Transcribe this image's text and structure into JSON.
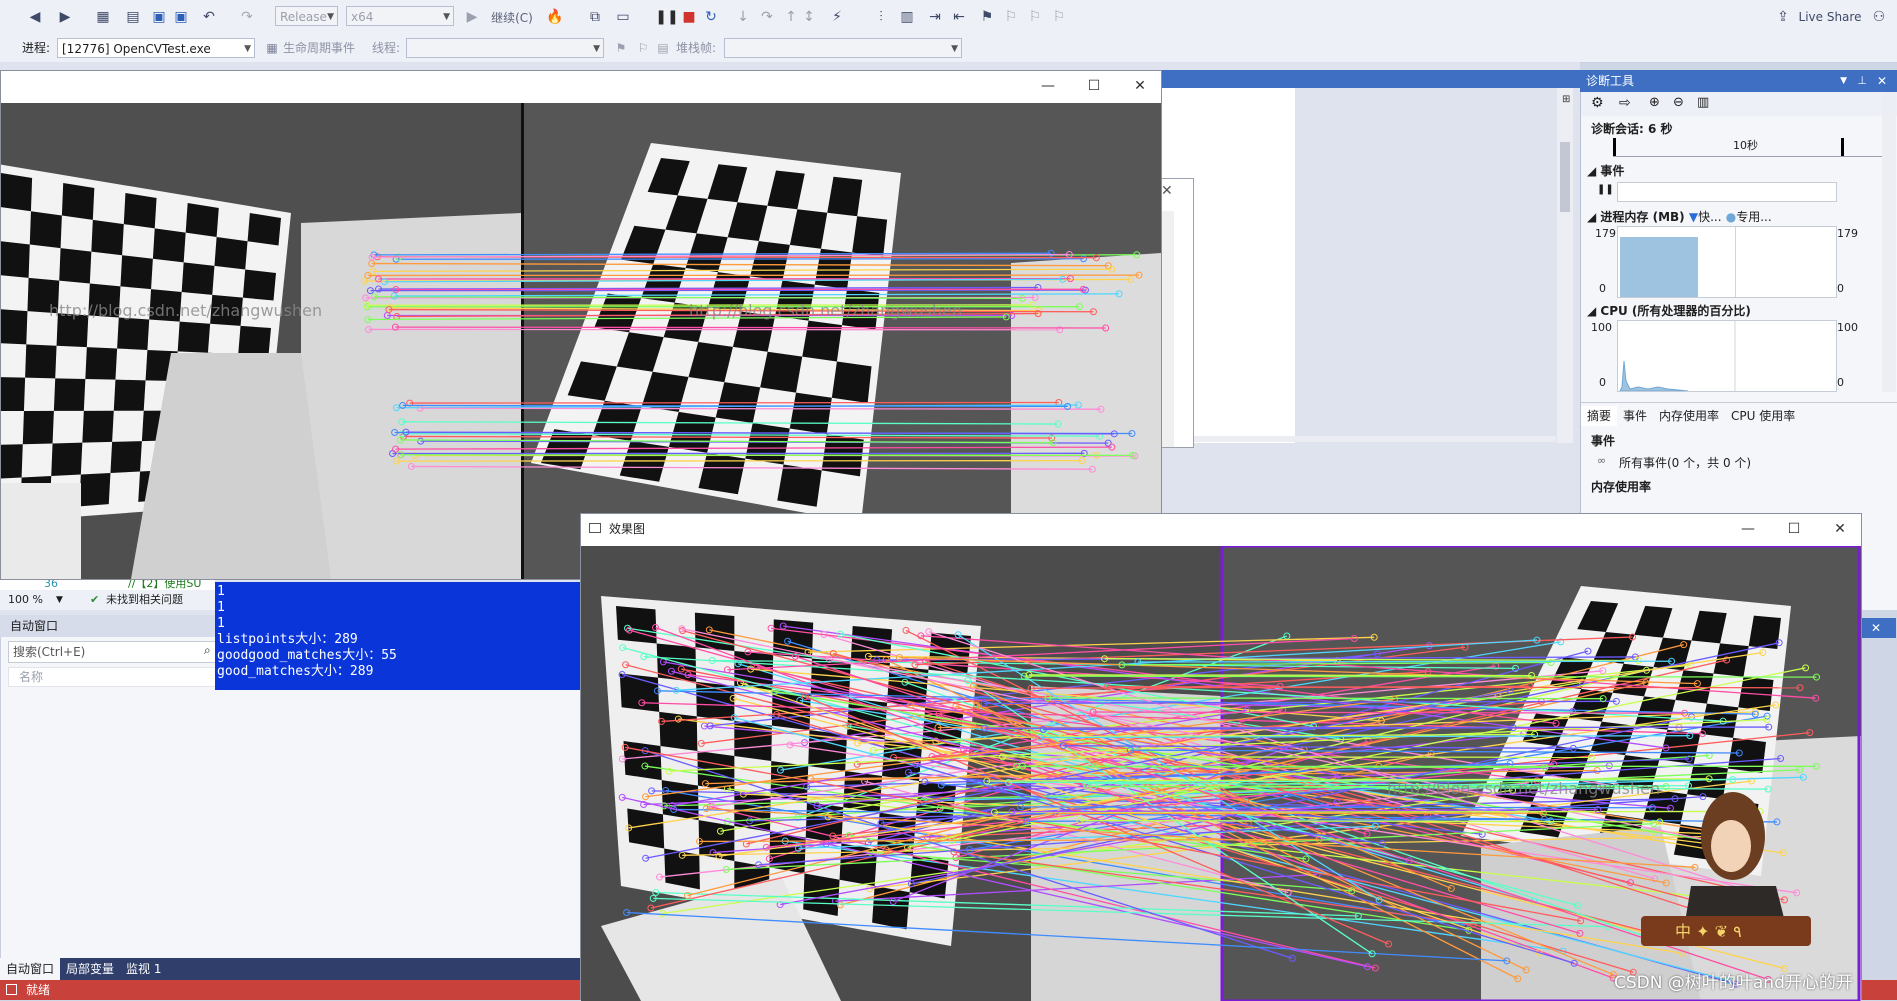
{
  "toolbar": {
    "configuration": "Release",
    "platform": "x64",
    "continue_label": "继续(C)",
    "live_share": "Live Share"
  },
  "debug_bar": {
    "process_label": "进程:",
    "process_value": "[12776] OpenCVTest.exe",
    "lifecycle_label": "生命周期事件",
    "thread_label": "线程:",
    "stackframe_label": "堆栈帧:"
  },
  "editor": {
    "zoom": "100 %",
    "line_number": "36",
    "line_code": "//【2】使用SU",
    "issues": "未找到相关问题"
  },
  "auto_window": {
    "title": "自动窗口",
    "search_placeholder": "搜索(Ctrl+E)",
    "col_name": "名称",
    "tabs": [
      "自动窗口",
      "局部变量",
      "监视 1"
    ]
  },
  "status_bar": {
    "text": "就绪"
  },
  "console": {
    "lines": [
      "1",
      "1",
      "1",
      "listpoints大小：289",
      "goodgood_matches大小：55",
      "good_matches大小：289"
    ]
  },
  "diagnostics": {
    "title": "诊断工具",
    "session": "诊断会话: 6 秒",
    "timeline_tick": "10秒",
    "events_header": "事件",
    "memory_header": "进程内存 (MB)",
    "memory_legend_1": "快...",
    "memory_legend_2": "专用...",
    "mem_max": "179",
    "mem_min": "0",
    "cpu_header": "CPU (所有处理器的百分比)",
    "cpu_max": "100",
    "cpu_min": "0",
    "tabs": [
      "摘要",
      "事件",
      "内存使用率",
      "CPU 使用率"
    ],
    "summary_events": "事件",
    "all_events": "所有事件(0 个，共 0 个)",
    "memory_usage": "内存使用率",
    "memory_fill_fraction": 0.85,
    "colors": {
      "memory": "#9ec3e1",
      "accent": "#3f6fc2"
    }
  },
  "window_top": {
    "watermark": "http://blog.csdn.net/zhangwushen"
  },
  "window_bottom": {
    "title": "效果图",
    "watermark": "http://blog.csdn.net/zhangwushen",
    "badge_text": "中 ✦ ❦ ٩"
  },
  "credit": "CSDN @树叶的叶and开心的开"
}
